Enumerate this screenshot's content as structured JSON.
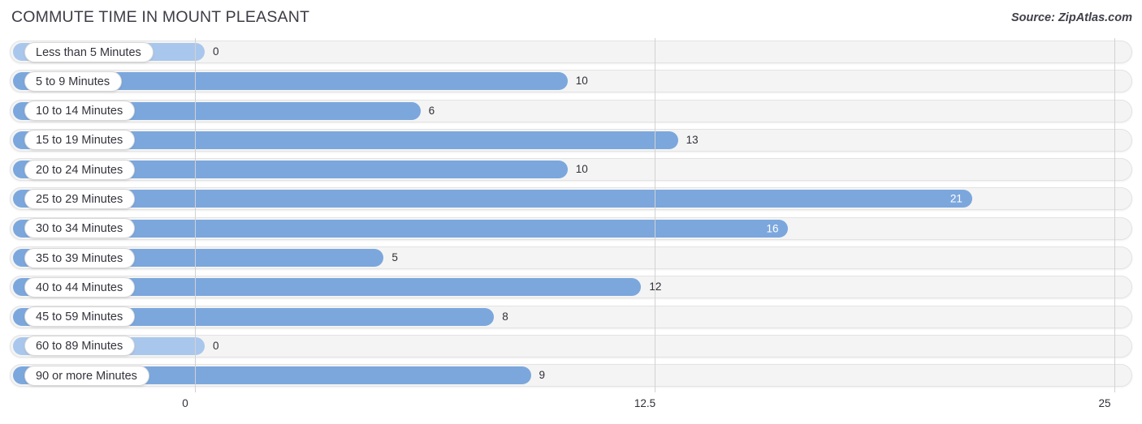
{
  "header": {
    "title": "COMMUTE TIME IN MOUNT PLEASANT",
    "source": "Source: ZipAtlas.com"
  },
  "colors": {
    "bar": "#7ba7dd",
    "bar_zero": "#a9c7ec",
    "track": "#f4f4f4",
    "gridline": "#d2d2d2",
    "text": "#2f2f38"
  },
  "chart_data": {
    "type": "bar",
    "orientation": "horizontal",
    "title": "COMMUTE TIME IN MOUNT PLEASANT",
    "xlabel": "",
    "ylabel": "",
    "xlim": [
      0,
      25
    ],
    "grid": true,
    "legend": "none",
    "xticks": [
      "0",
      "12.5",
      "25"
    ],
    "xtick_values": [
      0,
      12.5,
      25
    ],
    "categories": [
      "Less than 5 Minutes",
      "5 to 9 Minutes",
      "10 to 14 Minutes",
      "15 to 19 Minutes",
      "20 to 24 Minutes",
      "25 to 29 Minutes",
      "30 to 34 Minutes",
      "35 to 39 Minutes",
      "40 to 44 Minutes",
      "45 to 59 Minutes",
      "60 to 89 Minutes",
      "90 or more Minutes"
    ],
    "values": [
      0,
      10,
      6,
      13,
      10,
      21,
      16,
      5,
      12,
      8,
      0,
      9
    ],
    "value_labels": [
      "0",
      "10",
      "6",
      "13",
      "10",
      "21",
      "16",
      "5",
      "12",
      "8",
      "0",
      "9"
    ],
    "label_placement": [
      "outside",
      "outside",
      "outside",
      "outside",
      "outside",
      "inside",
      "inside",
      "outside",
      "outside",
      "outside",
      "outside",
      "outside"
    ]
  }
}
